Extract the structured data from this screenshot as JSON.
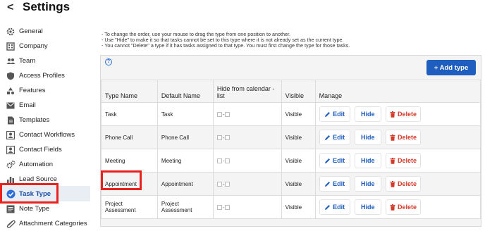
{
  "header": {
    "back_glyph": "<",
    "title": "Settings"
  },
  "sidebar": {
    "items": [
      {
        "label": "General",
        "icon": "gear-icon"
      },
      {
        "label": "Company",
        "icon": "building-icon"
      },
      {
        "label": "Team",
        "icon": "team-icon"
      },
      {
        "label": "Access Profiles",
        "icon": "shield-icon"
      },
      {
        "label": "Features",
        "icon": "features-icon"
      },
      {
        "label": "Email",
        "icon": "envelope-icon"
      },
      {
        "label": "Templates",
        "icon": "document-icon"
      },
      {
        "label": "Contact Workflows",
        "icon": "contact-card-icon"
      },
      {
        "label": "Contact Fields",
        "icon": "contact-card-icon"
      },
      {
        "label": "Automation",
        "icon": "gears-icon"
      },
      {
        "label": "Lead Source",
        "icon": "bar-chart-icon"
      },
      {
        "label": "Task Type",
        "icon": "check-circle-icon",
        "active": true
      },
      {
        "label": "Note Type",
        "icon": "note-icon"
      },
      {
        "label": "Attachment Categories",
        "icon": "paperclip-icon"
      }
    ]
  },
  "instructions": {
    "line1": "- To change the order, use your mouse to drag the type from one position to another.",
    "line2": "- Use \"Hide\" to make it so that tasks cannot be set to this type where it is not already set as the current type.",
    "line3": "- You cannot \"Delete\" a type if it has tasks assigned to that type. You must first change the type for those tasks."
  },
  "panel": {
    "help_glyph": "?",
    "add_button": "+ Add type",
    "columns": {
      "type_name": "Type Name",
      "default_name": "Default Name",
      "hide_from_calendar": "Hide from calendar - list",
      "visible": "Visible",
      "manage": "Manage"
    },
    "rows": [
      {
        "type_name": "Task",
        "default_name": "Task",
        "visible": "Visible"
      },
      {
        "type_name": "Phone Call",
        "default_name": "Phone Call",
        "visible": "Visible"
      },
      {
        "type_name": "Meeting",
        "default_name": "Meeting",
        "visible": "Visible"
      },
      {
        "type_name": "Appointment",
        "default_name": "Appointment",
        "visible": "Visible"
      },
      {
        "type_name": "Project Assessment",
        "default_name": "Project Assessment",
        "visible": "Visible"
      }
    ],
    "actions": {
      "edit": "Edit",
      "hide": "Hide",
      "delete": "Delete",
      "separator": "-"
    }
  },
  "colors": {
    "accent": "#1f5ebf",
    "danger": "#d43a2a",
    "highlight": "#e8211d",
    "active_bg": "#e9eef5"
  }
}
